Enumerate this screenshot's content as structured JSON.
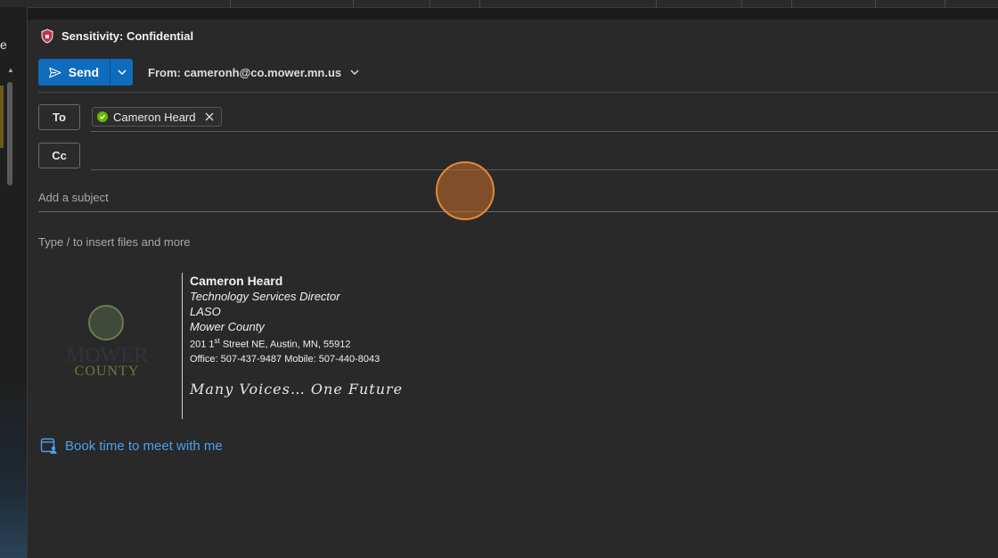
{
  "sidebar": {
    "partial_char": "e"
  },
  "sensitivity": {
    "label": "Sensitivity: Confidential"
  },
  "toolbar": {
    "send_label": "Send",
    "from_label": "From: cameronh@co.mower.mn.us"
  },
  "recipients": {
    "to_label": "To",
    "cc_label": "Cc",
    "to_chip": "Cameron Heard"
  },
  "subject": {
    "placeholder": "Add a subject"
  },
  "body": {
    "hint": "Type / to insert files and more"
  },
  "signature": {
    "logo_line1": "MOWER",
    "logo_line2": "COUNTY",
    "name": "Cameron Heard",
    "title": "Technology Services Director",
    "org_line": "LASO",
    "county": "Mower County",
    "address_num": "201 1",
    "address_sup": "st",
    "address_rest": " Street NE, Austin, MN, 55912",
    "phones": "Office: 507-437-9487 Mobile: 507-440-8043",
    "motto": "Many Voices… One Future"
  },
  "booking": {
    "link": "Book time to meet with me"
  },
  "colors": {
    "accent": "#0f6cbd",
    "link": "#4aa0f0",
    "presence": "#6bb700",
    "shield": "#c4314b"
  }
}
